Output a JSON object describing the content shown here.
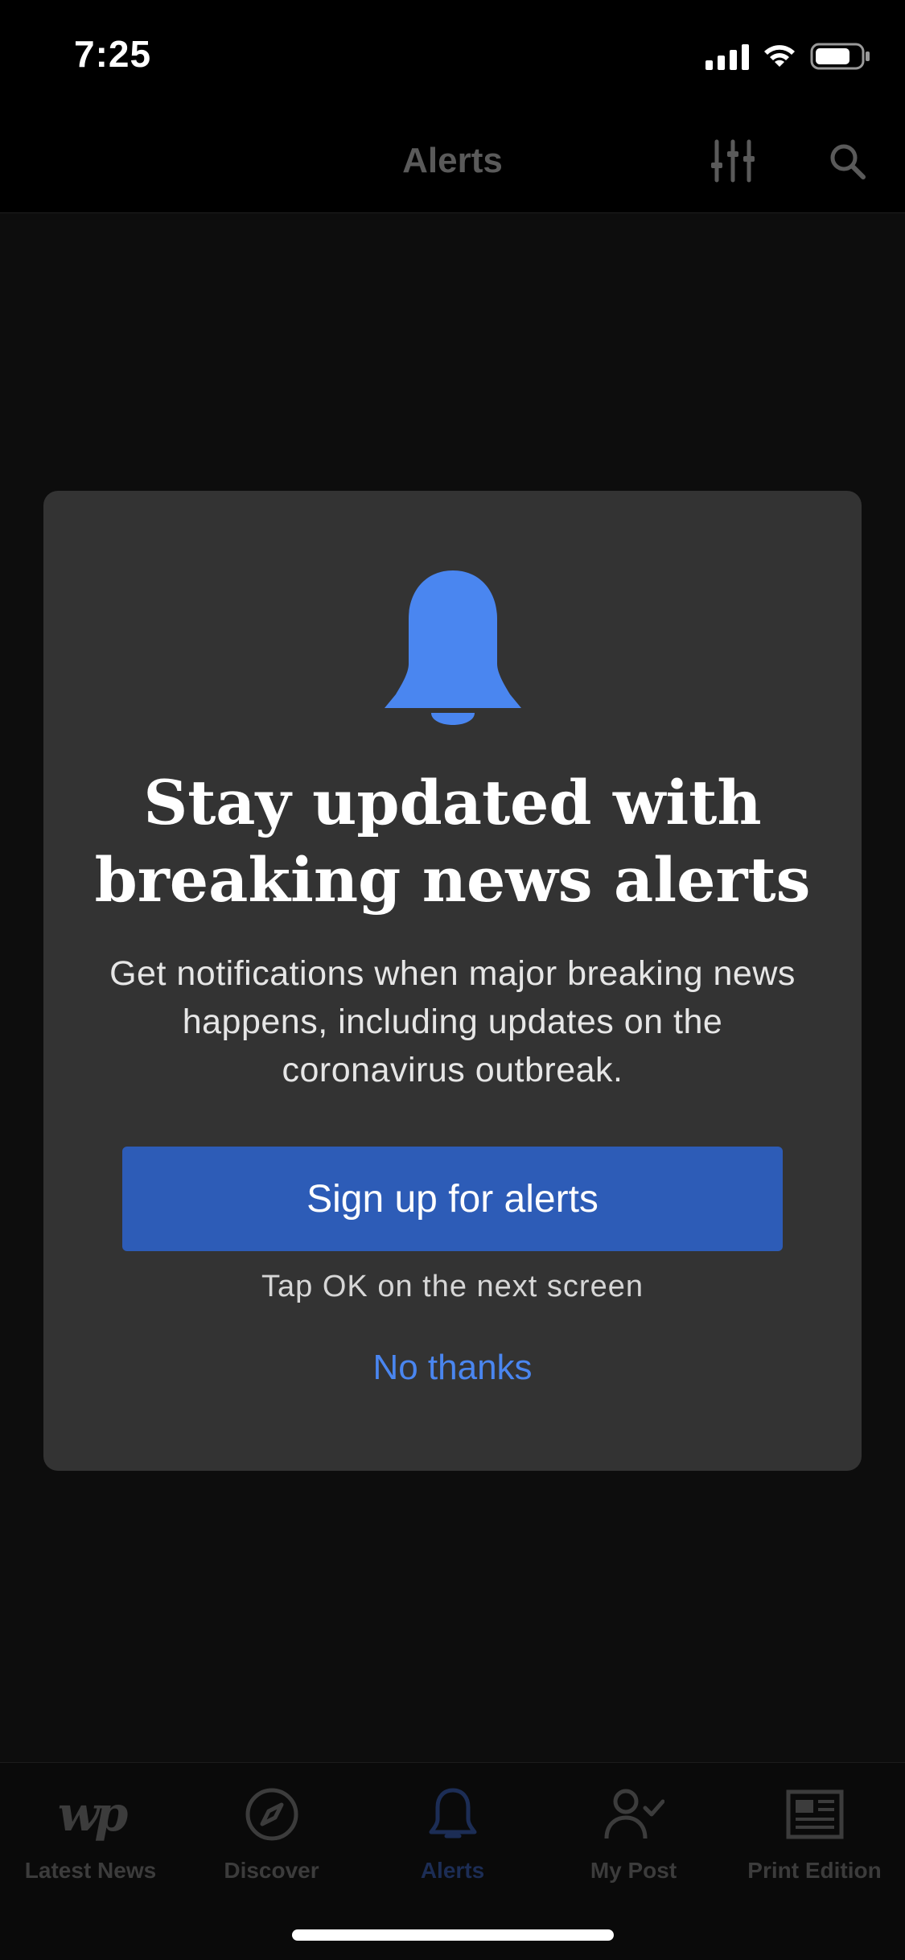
{
  "status_bar": {
    "time": "7:25"
  },
  "header": {
    "title": "Alerts",
    "filter_icon": "sliders-icon",
    "search_icon": "search-icon"
  },
  "modal": {
    "icon": "bell-icon",
    "title": "Stay updated with breaking news alerts",
    "body": "Get notifications when major breaking news happens, including updates on the coronavirus outbreak.",
    "primary_button": "Sign up for alerts",
    "hint": "Tap OK on the next screen",
    "secondary_link": "No thanks"
  },
  "tabs": [
    {
      "label": "Latest News",
      "icon": "wp-logo-icon",
      "active": false
    },
    {
      "label": "Discover",
      "icon": "compass-icon",
      "active": false
    },
    {
      "label": "Alerts",
      "icon": "bell-icon",
      "active": true
    },
    {
      "label": "My Post",
      "icon": "user-check-icon",
      "active": false
    },
    {
      "label": "Print Edition",
      "icon": "newspaper-icon",
      "active": false
    }
  ],
  "colors": {
    "accent_button": "#2d5cb7",
    "link": "#4a86f0",
    "bell": "#4a86f0",
    "active_tab": "#1c2d55"
  }
}
